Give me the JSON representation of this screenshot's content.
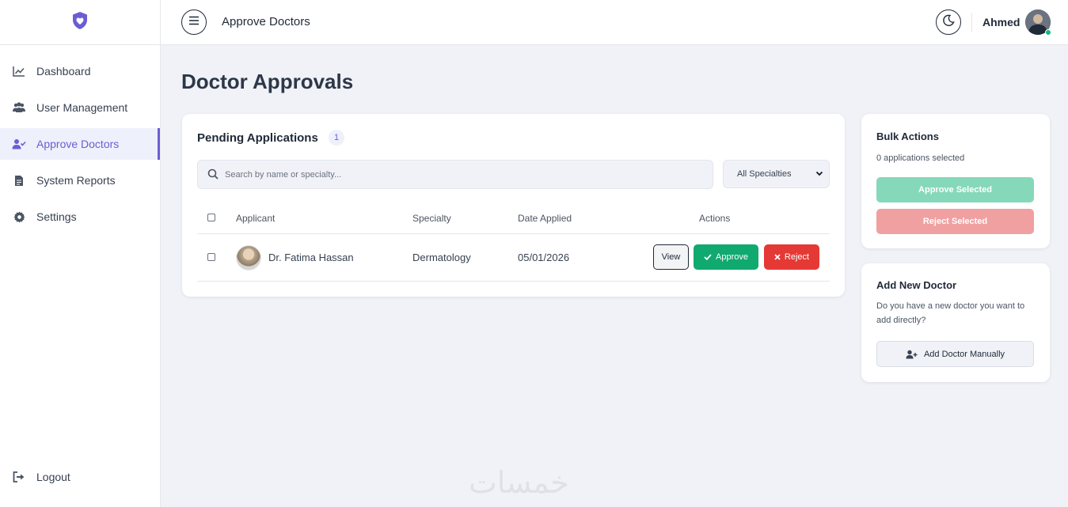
{
  "sidebar": {
    "logo_icon": "shield-heart-icon",
    "items": [
      {
        "label": "Dashboard",
        "icon": "chart-line-icon"
      },
      {
        "label": "User Management",
        "icon": "users-icon"
      },
      {
        "label": "Approve Doctors",
        "icon": "user-check-icon",
        "active": true
      },
      {
        "label": "System Reports",
        "icon": "file-report-icon"
      },
      {
        "label": "Settings",
        "icon": "gear-icon"
      }
    ],
    "logout_label": "Logout"
  },
  "topbar": {
    "title": "Approve Doctors",
    "user_name": "Ahmed"
  },
  "main": {
    "page_title": "Doctor Approvals",
    "pending": {
      "title": "Pending Applications",
      "count": "1",
      "search_placeholder": "Search by name or specialty...",
      "filter_selected": "All Specialties",
      "columns": [
        "Applicant",
        "Specialty",
        "Date Applied",
        "Actions"
      ],
      "rows": [
        {
          "name": "Dr. Fatima Hassan",
          "specialty": "Dermatology",
          "date": "05/01/2026"
        }
      ],
      "view_label": "View",
      "approve_label": "Approve",
      "reject_label": "Reject"
    },
    "bulk": {
      "title": "Bulk Actions",
      "selected_text": "0 applications selected",
      "approve_label": "Approve Selected",
      "reject_label": "Reject Selected"
    },
    "add_doctor": {
      "title": "Add New Doctor",
      "description": "Do you have a new doctor you want to add directly?",
      "button_label": "Add Doctor Manually"
    }
  },
  "watermark": "خمسات",
  "colors": {
    "accent": "#6d5dd3",
    "approve": "#10a96f",
    "reject": "#e53935",
    "background": "#f0f2f7"
  }
}
